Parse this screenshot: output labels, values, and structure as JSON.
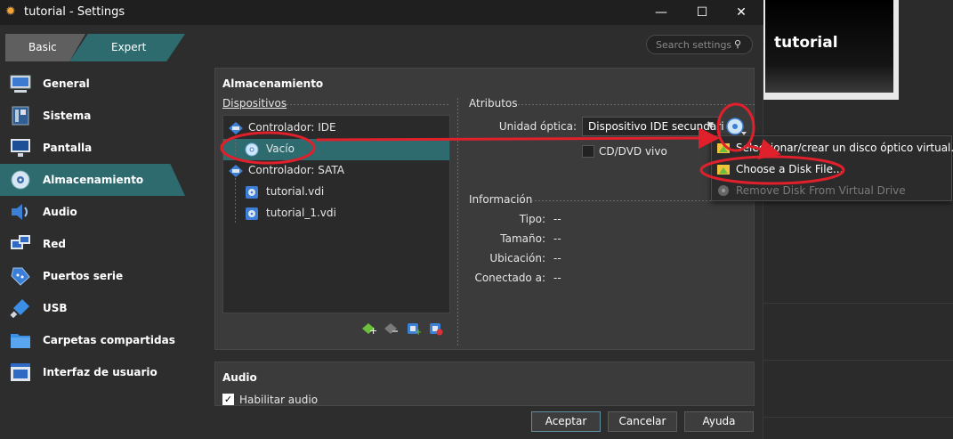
{
  "window": {
    "title": "tutorial - Settings",
    "minimize": "—",
    "maximize": "☐",
    "close": "✕"
  },
  "background_vm": {
    "preview_title": "tutorial"
  },
  "mode": {
    "basic": "Basic",
    "expert": "Expert",
    "selected": "Expert"
  },
  "search": {
    "placeholder": "Search settings"
  },
  "sidebar": {
    "items": [
      {
        "label": "General",
        "icon": "general-icon"
      },
      {
        "label": "Sistema",
        "icon": "system-icon"
      },
      {
        "label": "Pantalla",
        "icon": "display-icon"
      },
      {
        "label": "Almacenamiento",
        "icon": "storage-icon",
        "active": true
      },
      {
        "label": "Audio",
        "icon": "audio-icon"
      },
      {
        "label": "Red",
        "icon": "network-icon"
      },
      {
        "label": "Puertos serie",
        "icon": "serial-ports-icon"
      },
      {
        "label": "USB",
        "icon": "usb-icon"
      },
      {
        "label": "Carpetas compartidas",
        "icon": "shared-folders-icon"
      },
      {
        "label": "Interfaz de usuario",
        "icon": "user-interface-icon"
      }
    ]
  },
  "storage": {
    "title": "Almacenamiento",
    "devices_label": "Dispositivos",
    "tree": [
      {
        "label": "Controlador: IDE",
        "type": "controller"
      },
      {
        "label": "Vacío",
        "type": "optical",
        "selected": true
      },
      {
        "label": "Controlador: SATA",
        "type": "controller"
      },
      {
        "label": "tutorial.vdi",
        "type": "disk"
      },
      {
        "label": "tutorial_1.vdi",
        "type": "disk"
      }
    ],
    "attributes_label": "Atributos",
    "optical_drive_label": "Unidad óptica:",
    "optical_drive_value": "Dispositivo IDE secundari",
    "live_cd_label": "CD/DVD vivo",
    "info_label": "Información",
    "info": [
      {
        "key": "Tipo:",
        "value": "--"
      },
      {
        "key": "Tamaño:",
        "value": "--"
      },
      {
        "key": "Ubicación:",
        "value": "--"
      },
      {
        "key": "Conectado a:",
        "value": "--"
      }
    ]
  },
  "popup_menu": {
    "items": [
      {
        "label": "Seleccionar/crear un disco óptico virtual...",
        "enabled": true
      },
      {
        "label": "Choose a Disk File...",
        "enabled": true
      },
      {
        "label": "Remove Disk From Virtual Drive",
        "enabled": false
      }
    ]
  },
  "audio": {
    "title": "Audio",
    "enable_label": "Habilitar audio",
    "enabled": true
  },
  "buttons": {
    "ok": "Aceptar",
    "cancel": "Cancelar",
    "help": "Ayuda"
  },
  "colors": {
    "accent": "#2e6b6f",
    "annotation": "#e0202a",
    "background": "#2d2d2d"
  }
}
